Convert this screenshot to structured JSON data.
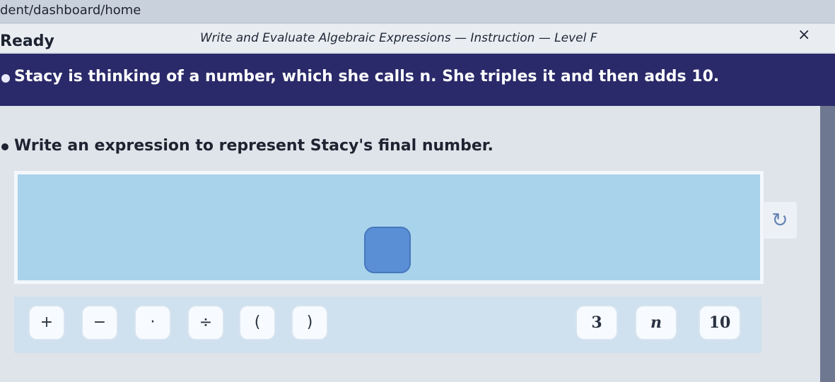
{
  "browser": {
    "url": "dent/dashboard/home"
  },
  "header": {
    "status": "Ready",
    "title": "Write and Evaluate Algebraic Expressions — Instruction — Level F",
    "close": "×"
  },
  "problem": {
    "statement": "Stacy is thinking of a number, which she calls n. She triples it and then adds 10.",
    "prompt": "Write an expression to represent Stacy's final number."
  },
  "answer": {
    "reset_symbol": "↻"
  },
  "keypad": {
    "operators": [
      "+",
      "−",
      "·",
      "÷",
      "(",
      ")"
    ],
    "tiles": [
      "3",
      "n",
      "10"
    ]
  },
  "colors": {
    "banner": "#2a2a6a",
    "answer_area": "#a9d3ea",
    "answer_slot": "#5a8fd6",
    "keypad": "#cfe0ee"
  }
}
